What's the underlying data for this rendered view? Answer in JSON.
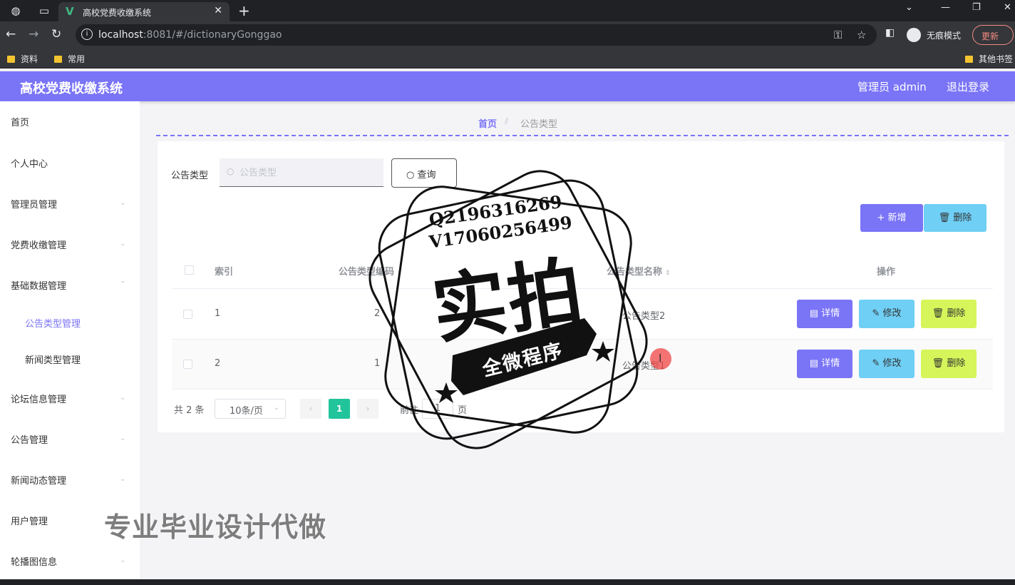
{
  "browser": {
    "tab_title": "高校党费收缴系统",
    "url_host": "localhost",
    "url_rest": ":8081/#/dictionaryGonggao",
    "incognito_label": "无痕模式",
    "update_label": "更新",
    "bookmarks": [
      "资料",
      "常用"
    ],
    "other_bookmarks": "其他书签",
    "icons": [
      "globe-icon",
      "tab-icon",
      "vue-favicon",
      "close-icon",
      "plus-icon",
      "back-icon",
      "forward-icon",
      "reload-icon",
      "info-icon",
      "key-icon",
      "star-icon",
      "sidepanel-icon",
      "incognito-icon",
      "menu-icon"
    ]
  },
  "header": {
    "title": "高校党费收缴系统",
    "admin_label": "管理员 admin",
    "logout_label": "退出登录",
    "color": "#7a74f7"
  },
  "sidebar": {
    "items": [
      {
        "label": "首页"
      },
      {
        "label": "个人中心"
      },
      {
        "label": "管理员管理"
      },
      {
        "label": "党费收缴管理"
      },
      {
        "label": "基础数据管理"
      },
      {
        "label": "公告类型管理",
        "sub": true,
        "active": true
      },
      {
        "label": "新闻类型管理",
        "sub": true
      },
      {
        "label": "论坛信息管理"
      },
      {
        "label": "公告管理"
      },
      {
        "label": "新闻动态管理"
      },
      {
        "label": "用户管理"
      },
      {
        "label": "轮播图信息"
      }
    ]
  },
  "breadcrumb": {
    "home": "首页",
    "current": "公告类型"
  },
  "search": {
    "label": "公告类型",
    "placeholder": "公告类型",
    "query_label": "查询"
  },
  "actions": {
    "add_label": "新增",
    "delete_label": "删除"
  },
  "table": {
    "columns": [
      "索引",
      "公告类型编码",
      "公告类型名称",
      "操作"
    ],
    "rows": [
      {
        "index": "1",
        "code": "2",
        "name": "公告类型2"
      },
      {
        "index": "2",
        "code": "1",
        "name": "公告类型1"
      }
    ],
    "row_actions": {
      "detail": "详情",
      "edit": "修改",
      "delete": "删除"
    }
  },
  "pagination": {
    "total": "共 2 条",
    "page_size": "10条/页",
    "current_page": "1",
    "goto_label": "前往",
    "goto_value": "1",
    "page_unit": "页",
    "active_color": "#21c49b"
  },
  "overlay": {
    "stamp_line1": "Q2196316269",
    "stamp_line2": "V17060256499",
    "stamp_big": "实拍",
    "stamp_ribbon": "全微程序",
    "watermark": "专业毕业设计代做"
  }
}
